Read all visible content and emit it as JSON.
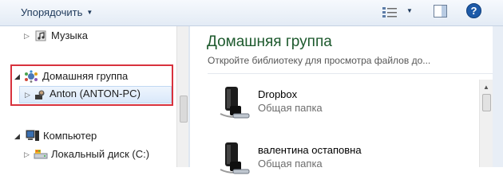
{
  "toolbar": {
    "organize_label": "Упорядочить",
    "organize_arrow": "▼",
    "views_arrow": "▼",
    "icons": [
      "views-icon",
      "preview-pane-icon",
      "help-icon"
    ]
  },
  "nav": {
    "items": [
      {
        "label": "Музыка",
        "icon": "music-icon"
      },
      {
        "label": "Домашняя группа",
        "icon": "homegroup-icon"
      },
      {
        "label": "Anton (ANTON-PC)",
        "icon": "user-icon"
      },
      {
        "label": "Компьютер",
        "icon": "computer-icon"
      },
      {
        "label": "Локальный диск (C:)",
        "icon": "local-disk-icon"
      }
    ],
    "collapsed_triangle": "▷",
    "expanded_triangle": "◢"
  },
  "content": {
    "title": "Домашняя группа",
    "subtitle": "Откройте библиотеку для просмотра файлов до...",
    "entries": [
      {
        "name": "Dropbox",
        "desc": "Общая папка",
        "icon": "shared-folder-icon"
      },
      {
        "name": "валентина остаповна",
        "desc": "Общая папка",
        "icon": "shared-folder-icon"
      }
    ]
  },
  "colors": {
    "highlight": "#d8323d",
    "title_green": "#1e5a2e",
    "help_blue": "#1d5aa8"
  }
}
